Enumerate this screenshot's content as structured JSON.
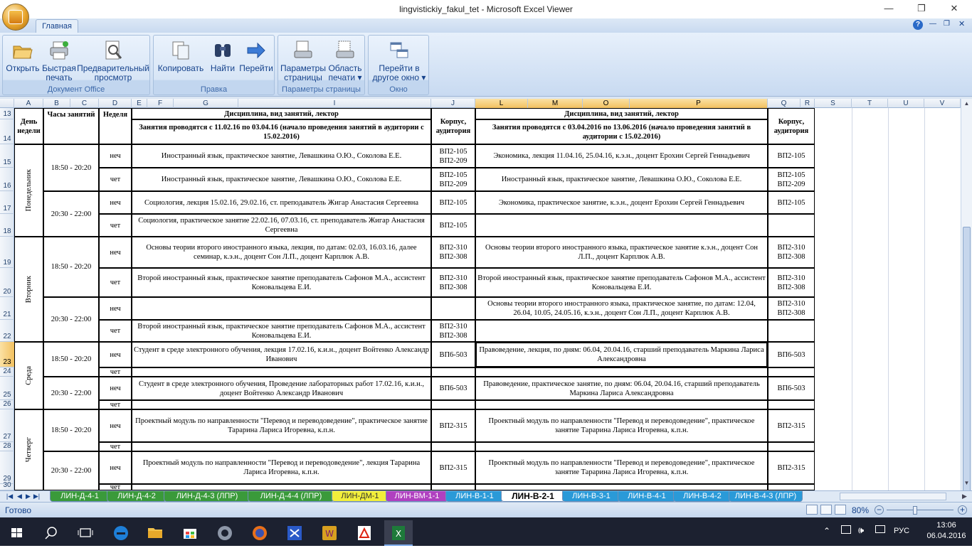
{
  "window": {
    "title": "lingvistickiy_fakul_tet - Microsoft Excel Viewer",
    "minimize": "—",
    "maximize": "❐",
    "close": "✕"
  },
  "ribbon": {
    "tab_home": "Главная",
    "groups": [
      {
        "label": "Документ Office",
        "buttons": [
          {
            "label": "Открыть",
            "icon": "open-folder-icon"
          },
          {
            "label": "Быстрая печать",
            "icon": "quick-print-icon"
          },
          {
            "label": "Предварительный просмотр",
            "icon": "print-preview-icon"
          }
        ]
      },
      {
        "label": "Правка",
        "buttons": [
          {
            "label": "Копировать",
            "icon": "copy-icon"
          },
          {
            "label": "Найти",
            "icon": "binoculars-icon"
          },
          {
            "label": "Перейти",
            "icon": "arrow-right-icon"
          }
        ]
      },
      {
        "label": "Параметры страницы",
        "buttons": [
          {
            "label": "Параметры страницы",
            "icon": "page-setup-icon"
          },
          {
            "label": "Область печати ▾",
            "icon": "print-area-icon"
          }
        ]
      },
      {
        "label": "Окно",
        "buttons": [
          {
            "label": "Перейти в другое окно ▾",
            "icon": "switch-window-icon"
          }
        ]
      }
    ]
  },
  "columns": [
    "A",
    "B",
    "C",
    "D",
    "E",
    "F",
    "G",
    "I",
    "J",
    "L",
    "M",
    "O",
    "P",
    "Q",
    "R",
    "S",
    "T",
    "U",
    "V"
  ],
  "rows": [
    "13",
    "14",
    "15",
    "16",
    "17",
    "18",
    "19",
    "20",
    "21",
    "22",
    "23",
    "24",
    "25",
    "26",
    "27",
    "28",
    "29",
    "30"
  ],
  "table": {
    "h_day": "День недели",
    "h_hours": "Часы занятий",
    "h_week": "Неделя",
    "h_disc": "Дисциплина, вид занятий, лектор",
    "h_period1": "Занятия проводятся с 11.02.16 по 03.04.16 (начало проведения занятий в аудитории с 15.02.2016)",
    "h_room": "Корпус, аудитория",
    "h_disc2": "Дисциплина, вид занятий, лектор",
    "h_period2": "Занятия проводятся с 03.04.2016 по 13.06.2016  (начало проведения занятий в аудитории с 15.02.2016)",
    "h_room2": "Корпус, аудитория",
    "days": [
      "Понедельник",
      "Вторник",
      "Среда",
      "Четверг"
    ],
    "times": [
      "18:50 - 20:20",
      "20:30 - 22:00",
      "18:50 - 20:20",
      "20:30 - 22:00",
      "18:50 - 20:20",
      "20:30 - 22:00",
      "18:50 - 20:20",
      "20:30 - 22:00"
    ],
    "weeks": [
      "неч",
      "чет",
      "неч",
      "чет",
      "неч",
      "чет",
      "неч",
      "чет",
      "неч",
      "чет",
      "неч",
      "чет",
      "неч",
      "чет",
      "неч",
      "чет"
    ],
    "d1": [
      "Иностранный язык, практическое занятие,  Левашкина О.Ю., Соколова Е.Е.",
      "Иностранный язык, практическое занятие,  Левашкина О.Ю., Соколова Е.Е.",
      "Социология, лекция 15.02.16, 29.02.16,  ст. преподаватель Жигар Анастасия Сергеевна",
      "Социология, практическое занятие 22.02.16, 07.03.16,  ст. преподаватель Жигар Анастасия Сергеевна",
      "Основы теории второго иностранного языка, лекция, по датам: 02.03, 16.03.16, далее семинар,  к.э.н., доцент Сон Л.П., доцент Карплюк А.В.",
      "Второй иностранный язык, практическое занятие преподаватель Сафонов М.А., ассистент Коновальцева Е.И.",
      "",
      "Второй иностранный язык, практическое занятие преподаватель Сафонов М.А., ассистент Коновальцева Е.И.",
      "Студент в среде электронного обучения, лекция 17.02.16, к.и.н., доцент Войтенко Александр Иванович",
      "",
      "Студент в среде электронного обучения, Проведение лабораторных работ 17.02.16, к.и.н., доцент Войтенко Александр Иванович",
      "",
      "Проектный модуль по направленности \"Перевод и переводоведение\", практическое занятие Тарарина Лариса Игоревна, к.п.н.",
      "",
      "Проектный модуль по направленности \"Перевод и переводоведение\", лекция Тарарина Лариса Игоревна, к.п.н.",
      ""
    ],
    "r1": [
      "ВП2-105 ВП2-209",
      "ВП2-105 ВП2-209",
      "ВП2-105",
      "ВП2-105",
      "ВП2-310 ВП2-308",
      "ВП2-310 ВП2-308",
      "",
      "ВП2-310 ВП2-308",
      "ВП6-503",
      "",
      "ВП6-503",
      "",
      "ВП2-315",
      "",
      "ВП2-315",
      ""
    ],
    "d2": [
      "Экономика, лекция 11.04.16, 25.04.16, к.э.н., доцент Ерохин Сергей Геннадьевич",
      "Иностранный язык, практическое занятие,  Левашкина О.Ю., Соколова Е.Е.",
      "Экономика, практическое занятие, к.э.н., доцент Ерохин Сергей Геннадьевич",
      "",
      "Основы теории второго иностранного языка, практическое занятие  к.э.н., доцент Сон Л.П., доцент Карплюк А.В.",
      "Второй иностранный язык, практическое занятие преподаватель Сафонов М.А., ассистент Коновальцева Е.И.",
      "Основы теории второго иностранного языка, практическое занятие, по датам: 12.04, 26.04, 10.05, 24.05.16,  к.э.н., доцент Сон Л.П., доцент Карплюк А.В.",
      "",
      "Правоведение, лекция, по дням: 06.04, 20.04.16, старший преподаватель Маркина Лариса Александровна",
      "",
      "Правоведение, практическое занятие, по дням: 06.04, 20.04.16, старший преподаватель Маркина Лариса Александровна",
      "",
      "Проектный модуль по направленности \"Перевод и переводоведение\", практическое занятие Тарарина Лариса Игоревна, к.п.н.",
      "",
      "Проектный модуль по направленности \"Перевод и переводоведение\", практическое занятие Тарарина Лариса Игоревна, к.п.н.",
      ""
    ],
    "r2": [
      "ВП2-105",
      "ВП2-105 ВП2-209",
      "ВП2-105",
      "",
      "ВП2-310 ВП2-308",
      "ВП2-310 ВП2-308",
      "ВП2-310 ВП2-308",
      "",
      "ВП6-503",
      "",
      "ВП6-503",
      "",
      "ВП2-315",
      "",
      "ВП2-315",
      ""
    ]
  },
  "sheet_tabs": [
    {
      "label": "ЛИН-Д-4-1",
      "color": "#3a9a3a"
    },
    {
      "label": "ЛИН-Д-4-2",
      "color": "#3a9a3a"
    },
    {
      "label": "ЛИН-Д-4-3 (ЛПР)",
      "color": "#3a9a3a"
    },
    {
      "label": "ЛИН-Д-4-4 (ЛПР)",
      "color": "#3a9a3a"
    },
    {
      "label": "ЛИН-ДМ-1",
      "color": "#f2ef3a"
    },
    {
      "label": "ЛИН-ВМ-1-1",
      "color": "#b040c0"
    },
    {
      "label": "ЛИН-В-1-1",
      "color": "#2a9ad8"
    },
    {
      "label": "ЛИН-В-2-1",
      "color": "#ffffff",
      "active": true
    },
    {
      "label": "ЛИН-В-3-1",
      "color": "#2a9ad8"
    },
    {
      "label": "ЛИН-В-4-1",
      "color": "#2a9ad8"
    },
    {
      "label": "ЛИН-В-4-2",
      "color": "#2a9ad8"
    },
    {
      "label": "ЛИН-В-4-3 (ЛПР)",
      "color": "#2a9ad8"
    }
  ],
  "status": {
    "ready": "Готово",
    "zoom": "80%"
  },
  "taskbar": {
    "lang": "РУС",
    "time": "13:06",
    "date": "06.04.2016"
  }
}
